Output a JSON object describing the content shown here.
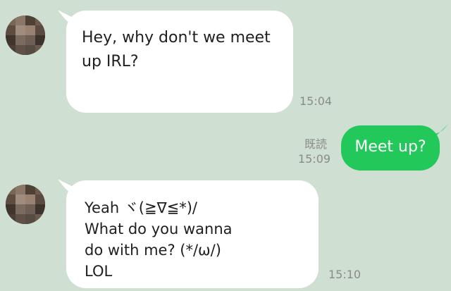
{
  "messages": [
    {
      "sender": "other",
      "text": "Hey, why don't we meet\nup IRL?",
      "time": "15:04"
    },
    {
      "sender": "me",
      "text": "Meet up?",
      "status": "既読",
      "time": "15:09"
    },
    {
      "sender": "other",
      "text": "Yeah ヾ(≧∇≦*)/\nWhat do you wanna\ndo with me? (*/ω/)\nLOL",
      "time": "15:10"
    }
  ],
  "colors": {
    "background": "#cfe0d2",
    "incoming_bubble": "#ffffff",
    "outgoing_bubble": "#22c85a",
    "timestamp": "#8a8a8a",
    "avatar_primary": "#6d5a4b"
  }
}
